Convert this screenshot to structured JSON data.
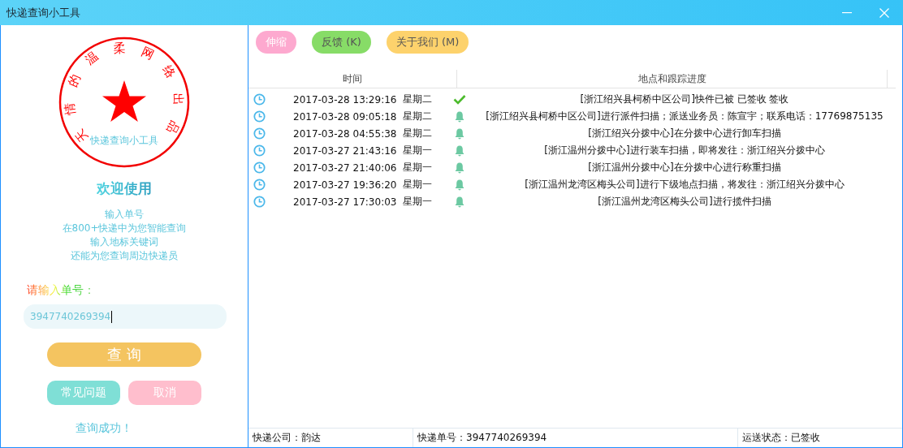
{
  "window": {
    "title": "快递查询小工具"
  },
  "left_panel": {
    "stamp": {
      "ring_text": "天情的温柔网络出品",
      "inner_text": "快递查询小工具"
    },
    "welcome": "欢迎使用",
    "intro_lines": [
      "输入单号",
      "在800+快递中为您智能查询",
      "输入地标关键词",
      "还能为您查询周边快递员"
    ],
    "input_label": "请输入单号：",
    "tracking_input": {
      "value": "3947740269394"
    },
    "buttons": [
      {
        "label": "查 询",
        "kind": "primary"
      },
      {
        "label": "常见问题",
        "kind": "faq"
      },
      {
        "label": "取消",
        "kind": "cancel"
      }
    ],
    "result": "查询成功！"
  },
  "toolbar": {
    "buttons": [
      {
        "label": "伸缩",
        "color": "#fda9cf"
      },
      {
        "label": "反馈 (K)",
        "color": "#87dc67"
      },
      {
        "label": "关于我们 (M)",
        "color": "#fdd26c"
      }
    ]
  },
  "table": {
    "columns": [
      "时间",
      "地点和跟踪进度"
    ],
    "rows": [
      {
        "time": "2017-03-28 13:29:16",
        "weekday": "星期二",
        "kind": "signed",
        "detail": "[浙江绍兴县柯桥中区公司]快件已被 已签收 签收"
      },
      {
        "time": "2017-03-28 09:05:18",
        "weekday": "星期二",
        "kind": "transit",
        "detail": "[浙江绍兴县柯桥中区公司]进行派件扫描；派送业务员：陈宣宇；联系电话：17769875135"
      },
      {
        "time": "2017-03-28 04:55:38",
        "weekday": "星期二",
        "kind": "transit",
        "detail": "[浙江绍兴分拨中心]在分拨中心进行卸车扫描"
      },
      {
        "time": "2017-03-27 21:43:16",
        "weekday": "星期一",
        "kind": "transit",
        "detail": "[浙江温州分拨中心]进行装车扫描，即将发往：浙江绍兴分拨中心"
      },
      {
        "time": "2017-03-27 21:40:06",
        "weekday": "星期一",
        "kind": "transit",
        "detail": "[浙江温州分拨中心]在分拨中心进行称重扫描"
      },
      {
        "time": "2017-03-27 19:36:20",
        "weekday": "星期一",
        "kind": "transit",
        "detail": "[浙江温州龙湾区梅头公司]进行下级地点扫描，将发往：浙江绍兴分拨中心"
      },
      {
        "time": "2017-03-27 17:30:03",
        "weekday": "星期一",
        "kind": "transit",
        "detail": "[浙江温州龙湾区梅头公司]进行揽件扫描"
      }
    ]
  },
  "status_bar": [
    "快递公司：韵达",
    "快递单号：3947740269394",
    "运送状态：已签收"
  ]
}
